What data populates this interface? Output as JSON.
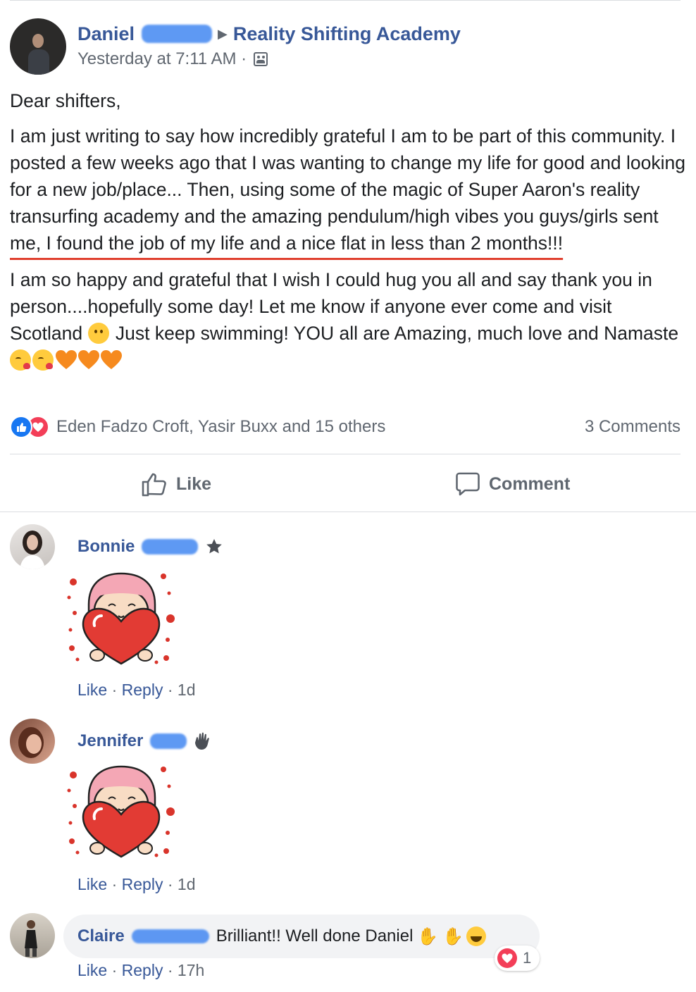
{
  "post": {
    "author": "Daniel",
    "group": "Reality Shifting Academy",
    "timestamp": "Yesterday at 7:11 AM ·",
    "greeting": "Dear shifters,",
    "para1_a": "I am just writing to say how incredibly grateful I am to be part of this community. I posted a few weeks ago that I was wanting to change my life for good and looking for a new job/place... Then, using some of the magic of Super Aaron's reality transurfing academy and the amazing pendulum/high vibes you guys/girls sent ",
    "para1_highlight": "me, I found the job of my life and a nice flat in less than 2 months!!!",
    "para2_a": "I am so happy and grateful that I wish I could hug you all and say thank you in person....hopefully some day! Let me know if anyone ever come and visit Scotland ",
    "para2_b": " Just keep swimming! YOU all are Amazing, much love and Namaste ",
    "reactions_text": "Eden Fadzo Croft, Yasir Buxx and 15 others",
    "comments_count": "3 Comments",
    "like_label": "Like",
    "comment_label": "Comment"
  },
  "comments": [
    {
      "name": "Bonnie",
      "like": "Like",
      "reply": "Reply",
      "time": "1d",
      "sep": "·"
    },
    {
      "name": "Jennifer",
      "like": "Like",
      "reply": "Reply",
      "time": "1d",
      "sep": "·"
    },
    {
      "name": "Claire",
      "text": "Brilliant!! Well done Daniel",
      "like": "Like",
      "reply": "Reply",
      "time": "17h",
      "sep": "·",
      "reaction_count": "1"
    }
  ],
  "colors": {
    "link": "#385898",
    "meta": "#606770",
    "like_blue": "#1877f2",
    "love_red": "#f33e58",
    "underline": "#e0402f"
  },
  "icons": [
    "group-privacy-icon",
    "thumbs-up-icon",
    "comment-bubble-icon",
    "star-badge-icon",
    "wave-badge-icon",
    "heart-sticker",
    "heart-reaction-icon"
  ]
}
